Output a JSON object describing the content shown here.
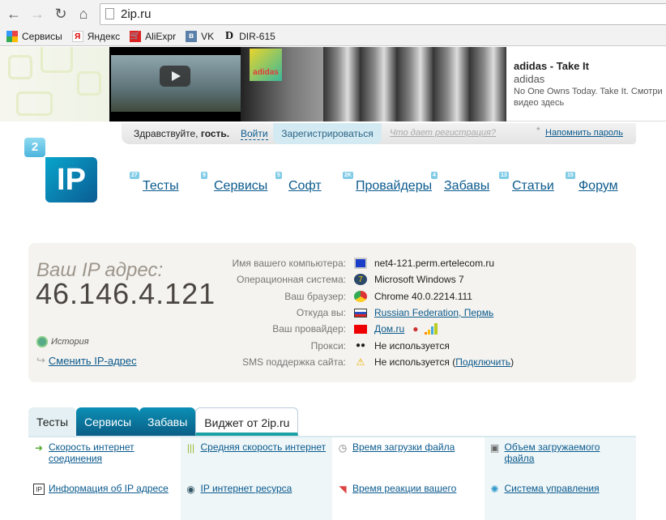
{
  "browser": {
    "url": "2ip.ru",
    "bookmarks": [
      {
        "label": "Сервисы",
        "icon": "apps-grid-icon"
      },
      {
        "label": "Яндекс",
        "icon": "yandex-icon"
      },
      {
        "label": "AliExpr",
        "icon": "cart-icon"
      },
      {
        "label": "VK",
        "icon": "vk-icon"
      },
      {
        "label": "DIR-615",
        "icon": "dlink-icon"
      }
    ]
  },
  "ad": {
    "title": "adidas - Take It",
    "channel": "adidas",
    "desc": "No One Owns Today. Take It. Смотри",
    "desc2": "видео здесь",
    "logo_text": "adidas"
  },
  "userbar": {
    "greeting": "Здравствуйте, ",
    "guest": "гость.",
    "login": "Войти",
    "register": "Зарегистрироваться",
    "why": "Что дает регистрация?",
    "star": "*",
    "remind": "Напомнить пароль"
  },
  "logo": {
    "two": "2",
    "ip": "IP"
  },
  "nav": [
    {
      "label": "Тесты",
      "count": "27"
    },
    {
      "label": "Сервисы",
      "count": "9"
    },
    {
      "label": "Софт",
      "count": "5"
    },
    {
      "label": "Провайдеры",
      "count": "2K"
    },
    {
      "label": "Забавы",
      "count": "4"
    },
    {
      "label": "Статьи",
      "count": "13"
    },
    {
      "label": "Форум",
      "count": "15"
    }
  ],
  "ip": {
    "label": "Ваш IP адрес:",
    "value": "46.146.4.121",
    "history": "История",
    "change": "Сменить IP-адрес"
  },
  "info": [
    {
      "label": "Имя вашего компьютера:",
      "value": "net4-121.perm.ertelecom.ru"
    },
    {
      "label": "Операционная система:",
      "value": "Microsoft Windows 7"
    },
    {
      "label": "Ваш браузер:",
      "value": "Chrome 40.0.2214.111"
    },
    {
      "label": "Откуда вы:",
      "value": "Russian Federation, Пермь"
    },
    {
      "label": "Ваш провайдер:",
      "value": "Дом.ru"
    },
    {
      "label": "Прокси:",
      "value": "Не используется"
    },
    {
      "label": "SMS поддержка сайта:",
      "value": "Не используется (",
      "link": "Подключить",
      "tail": ")"
    }
  ],
  "tabs": [
    "Тесты",
    "Сервисы",
    "Забавы",
    "Виджет от 2ip.ru"
  ],
  "services": [
    {
      "label": "Скорость интернет соединения"
    },
    {
      "label": "Средняя скорость интернет"
    },
    {
      "label": "Время загрузки файла"
    },
    {
      "label": "Объем загружаемого файла"
    },
    {
      "label": "Информация об IP адресе"
    },
    {
      "label": "IP интернет ресурса"
    },
    {
      "label": "Время реакции вашего"
    },
    {
      "label": "Система управления"
    }
  ]
}
